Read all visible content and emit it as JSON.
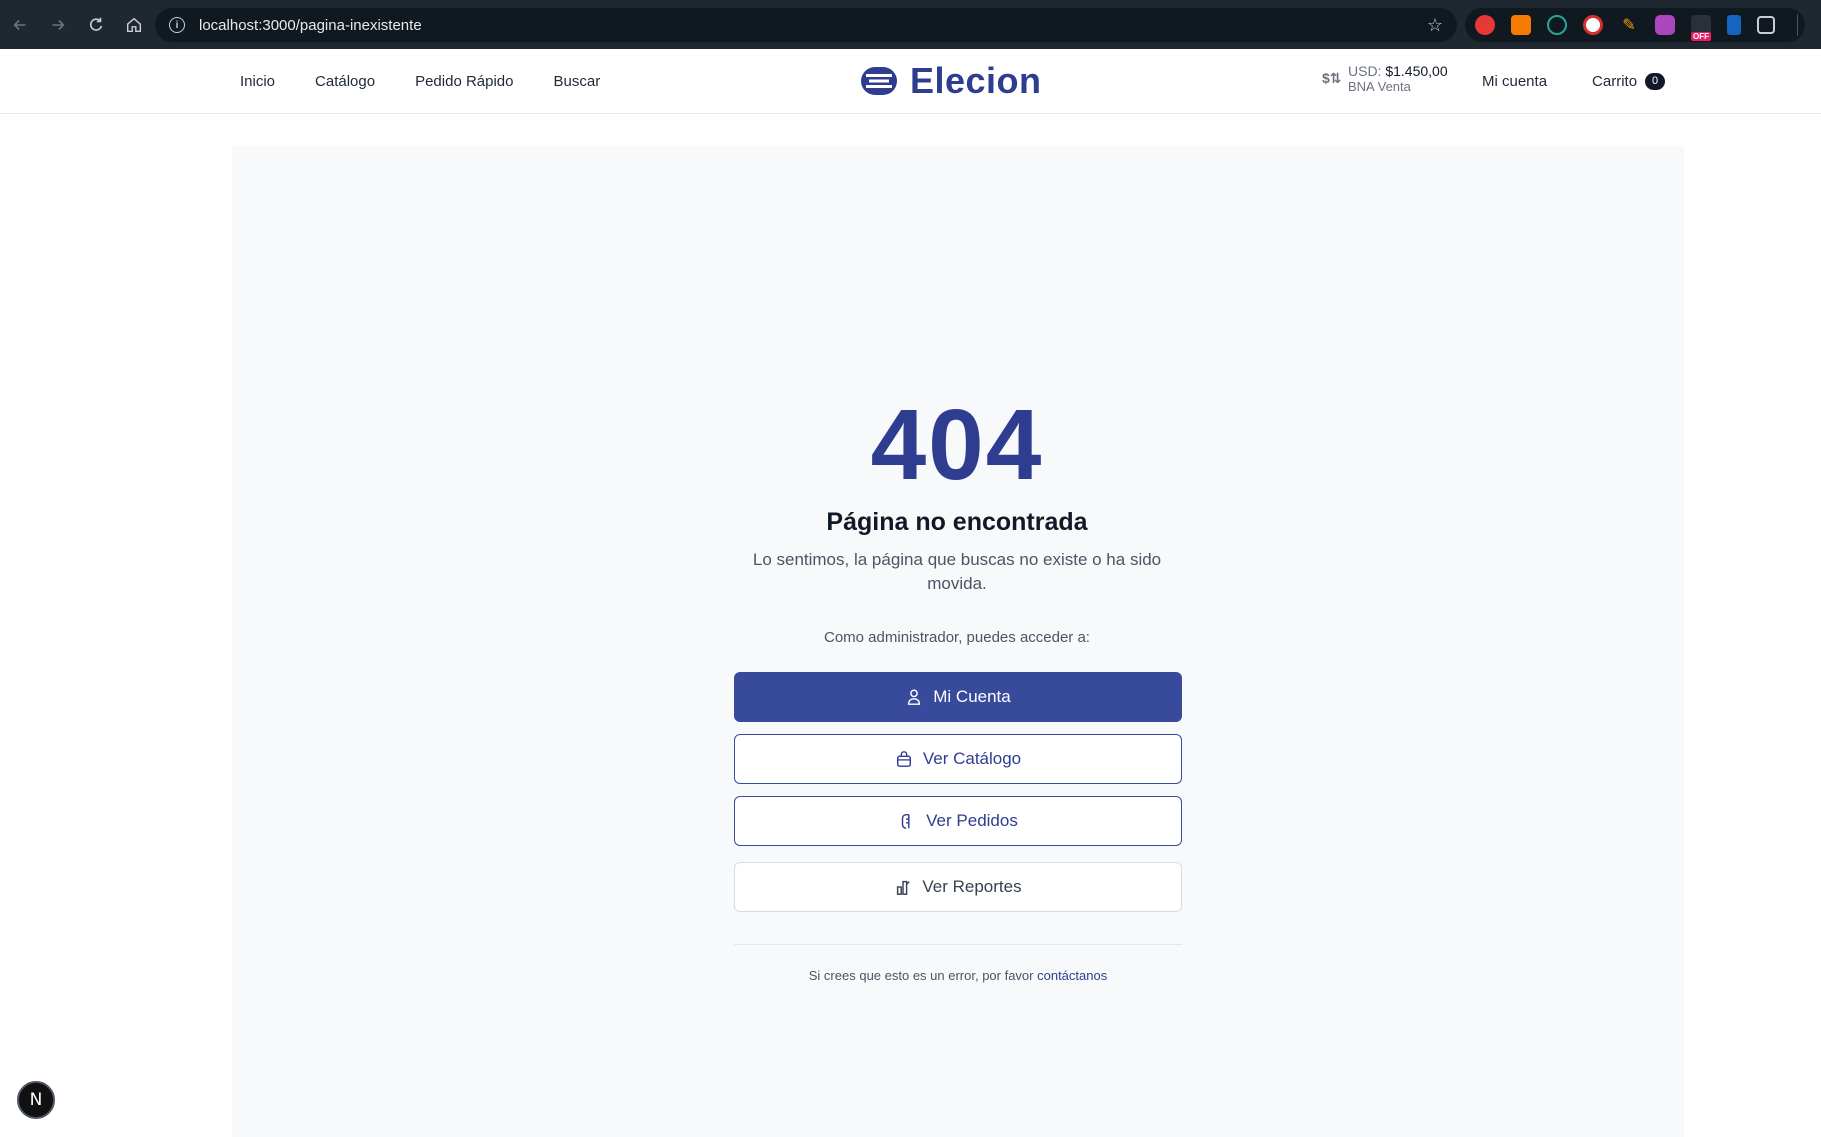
{
  "browser": {
    "url": "localhost:3000/pagina-inexistente",
    "ext_off_label": "OFF"
  },
  "header": {
    "nav_left": [
      "Inicio",
      "Catálogo",
      "Pedido Rápido",
      "Buscar"
    ],
    "logo_text": "Elecion",
    "fx_currency": "USD:",
    "fx_value": "$1.450,00",
    "fx_source": "BNA Venta",
    "account": "Mi cuenta",
    "cart": "Carrito",
    "cart_count": "0"
  },
  "error": {
    "code": "404",
    "title": "Página no encontrada",
    "message": "Lo sentimos, la página que buscas no existe o ha sido movida.",
    "admin_label": "Como administrador, puedes acceder a:"
  },
  "actions": {
    "account": "Mi Cuenta",
    "catalog": "Ver Catálogo",
    "orders": "Ver Pedidos",
    "reports": "Ver Reportes"
  },
  "footer": {
    "note": "Si crees que esto es un error, por favor ",
    "contact_link": "contáctanos"
  },
  "dev_badge": "N",
  "colors": {
    "brand": "#2f3d91",
    "primary_button": "#384a9c",
    "panel_bg": "#f8f9fb",
    "chrome_bg": "#1f2731"
  }
}
